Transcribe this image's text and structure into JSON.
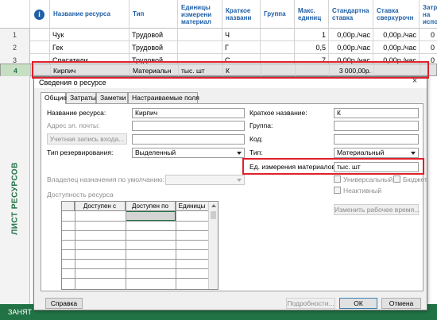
{
  "sheet": {
    "columns": [
      "",
      "Название ресурса",
      "Тип",
      "Единицы измерени материал",
      "Краткое названи",
      "Группа",
      "Макс. единиц",
      "Стандартна ставка",
      "Ставка сверхурочн",
      "Затр на испо"
    ],
    "rows": [
      {
        "num": "1",
        "name": "Чук",
        "type": "Трудовой",
        "units": "",
        "short": "Ч",
        "group": "",
        "max": "1",
        "std": "0,00р./час",
        "ovt": "0,00р./час",
        "cost": "0"
      },
      {
        "num": "2",
        "name": "Гек",
        "type": "Трудовой",
        "units": "",
        "short": "Г",
        "group": "",
        "max": "0,5",
        "std": "0,00р./час",
        "ovt": "0,00р./час",
        "cost": "0"
      },
      {
        "num": "3",
        "name": "Спасатели",
        "type": "Трудовой",
        "units": "",
        "short": "С",
        "group": "",
        "max": "7",
        "std": "0,00р./час",
        "ovt": "0,00р./час",
        "cost": "0"
      },
      {
        "num": "4",
        "name": "Кирпич",
        "type": "Материальн",
        "units": "тыс. шт",
        "short": "К",
        "group": "",
        "max": "",
        "std": "3 000,00р.",
        "ovt": "",
        "cost": ""
      }
    ],
    "side_label": "ЛИСТ РЕСУРСОВ",
    "status": "ЗАНЯТ"
  },
  "dialog": {
    "title": "Сведения о ресурсе",
    "close": "×",
    "tabs": [
      "Общие",
      "Затраты",
      "Заметки",
      "Настраиваемые поля"
    ],
    "left": {
      "name_label": "Название ресурса:",
      "name_value": "Кирпич",
      "email_label": "Адрес эл. почты:",
      "login_button": "Учетная запись входа...",
      "booking_label": "Тип резервирования:",
      "booking_value": "Выделенный",
      "owner_label": "Владелец назначения по умолчанию:",
      "availability_label": "Доступность ресурса",
      "grid_headers": [
        "Доступен с",
        "Доступен по",
        "Единицы"
      ]
    },
    "right": {
      "short_label": "Краткое название:",
      "short_value": "К",
      "group_label": "Группа:",
      "code_label": "Код:",
      "type_label": "Тип:",
      "type_value": "Материальный",
      "units_label": "Ед. измерения материалов:",
      "units_value": "тыс. шт",
      "generic_label": "Универсальный",
      "budget_label": "Бюджет",
      "inactive_label": "Неактивный",
      "change_calendar": "Изменить рабочее время..."
    },
    "footer": {
      "help": "Справка",
      "details": "Подробности...",
      "ok": "ОК",
      "cancel": "Отмена"
    }
  }
}
